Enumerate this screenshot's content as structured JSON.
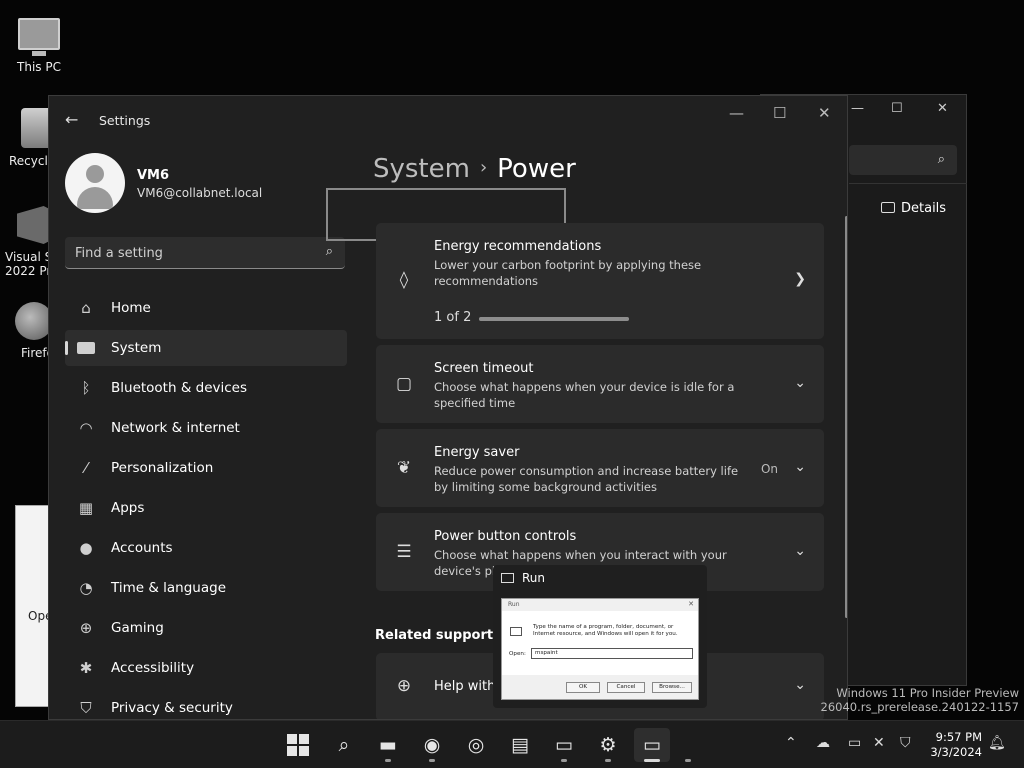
{
  "desktop": {
    "icons": [
      {
        "label": "This PC"
      },
      {
        "label": "Recycle"
      },
      {
        "label": "Visual St",
        "label2": "2022 Pre"
      },
      {
        "label": "Firefo"
      }
    ],
    "left_window_label": "Ope",
    "watermark": [
      "Windows 11 Pro Insider Preview",
      "26040.rs_prerelease.240122-1157"
    ]
  },
  "background_window": {
    "details_label": "Details"
  },
  "settings": {
    "app_title": "Settings",
    "user": {
      "name": "VM6",
      "email": "VM6@collabnet.local"
    },
    "search": {
      "placeholder": "Find a setting",
      "value": ""
    },
    "nav": [
      {
        "label": "Home",
        "icon": "home-icon"
      },
      {
        "label": "System",
        "icon": "system-icon",
        "active": true
      },
      {
        "label": "Bluetooth & devices",
        "icon": "bluetooth-icon"
      },
      {
        "label": "Network & internet",
        "icon": "wifi-icon"
      },
      {
        "label": "Personalization",
        "icon": "brush-icon"
      },
      {
        "label": "Apps",
        "icon": "apps-icon"
      },
      {
        "label": "Accounts",
        "icon": "person-icon"
      },
      {
        "label": "Time & language",
        "icon": "clock-globe-icon"
      },
      {
        "label": "Gaming",
        "icon": "gamepad-icon"
      },
      {
        "label": "Accessibility",
        "icon": "accessibility-icon"
      },
      {
        "label": "Privacy & security",
        "icon": "shield-icon"
      }
    ],
    "breadcrumb": {
      "parent": "System",
      "current": "Power"
    },
    "cards": {
      "energy": {
        "title": "Energy recommendations",
        "desc": "Lower your carbon footprint by applying these recommendations",
        "progress_text": "1 of 2",
        "progress": 1.0
      },
      "screen": {
        "title": "Screen timeout",
        "desc": "Choose what happens when your device is idle for a specified time"
      },
      "saver": {
        "title": "Energy saver",
        "desc": "Reduce power consumption and increase battery life by limiting some background activities",
        "status": "On"
      },
      "power_button": {
        "title": "Power button controls",
        "desc": "Choose what happens when you interact with your device's physical co"
      },
      "help": {
        "title": "Help with"
      }
    },
    "related_support": "Related support"
  },
  "run_preview": {
    "title": "Run",
    "dialog_title": "Run",
    "desc": "Type the name of a program, folder, document, or Internet resource, and Windows will open it for you.",
    "open_label": "Open:",
    "open_value": "mspaint",
    "ok": "OK",
    "cancel": "Cancel",
    "browse": "Browse..."
  },
  "taskbar": {
    "time": "9:57 PM",
    "date": "3/3/2024"
  }
}
